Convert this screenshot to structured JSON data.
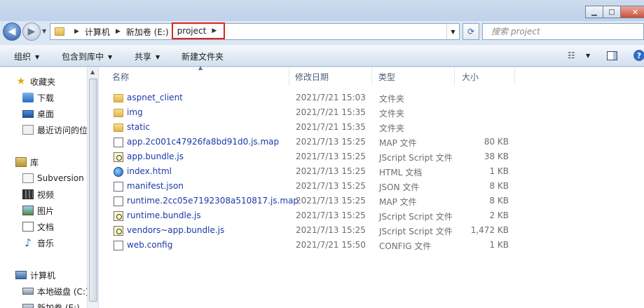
{
  "window": {
    "min_glyph": "▁",
    "max_glyph": "□",
    "close_glyph": "✕"
  },
  "address": {
    "back_glyph": "◀",
    "forward_glyph": "▶",
    "recent_glyph": "▼",
    "crumbs": [
      "计算机",
      "新加卷 (E:)",
      "project"
    ],
    "separator": "▶",
    "dropdown_glyph": "▼",
    "refresh_glyph": "⟳"
  },
  "search": {
    "placeholder": "搜索 project"
  },
  "toolbar": {
    "organize": "组织",
    "include_in_library": "包含到库中",
    "share": "共享",
    "new_folder": "新建文件夹",
    "dropdown_glyph": "▼",
    "views_glyph": "☷",
    "help_glyph": "?"
  },
  "nav": {
    "favorites": "收藏夹",
    "downloads": "下载",
    "desktop": "桌面",
    "recent": "最近访问的位置",
    "libraries": "库",
    "subversion": "Subversion",
    "videos": "视频",
    "pictures": "图片",
    "documents": "文档",
    "music": "音乐",
    "computer": "计算机",
    "local_disk": "本地磁盘 (C:)",
    "new_volume": "新加卷 (E:)",
    "star_glyph": "★",
    "music_glyph": "♪",
    "scroll_up_glyph": "▲"
  },
  "columns": {
    "name": "名称",
    "modified": "修改日期",
    "type": "类型",
    "size": "大小",
    "sort_glyph": "▲"
  },
  "files": [
    {
      "name": "aspnet_client",
      "modified": "2021/7/21 15:03",
      "type": "文件夹",
      "size": "",
      "icon": "folder-icon"
    },
    {
      "name": "img",
      "modified": "2021/7/21 15:35",
      "type": "文件夹",
      "size": "",
      "icon": "folder-icon"
    },
    {
      "name": "static",
      "modified": "2021/7/21 15:35",
      "type": "文件夹",
      "size": "",
      "icon": "folder-icon"
    },
    {
      "name": "app.2c001c47926fa8bd91d0.js.map",
      "modified": "2021/7/13 15:25",
      "type": "MAP 文件",
      "size": "80 KB",
      "icon": "file-icon"
    },
    {
      "name": "app.bundle.js",
      "modified": "2021/7/13 15:25",
      "type": "JScript Script 文件",
      "size": "38 KB",
      "icon": "script-icon"
    },
    {
      "name": "index.html",
      "modified": "2021/7/13 15:25",
      "type": "HTML 文档",
      "size": "1 KB",
      "icon": "html-icon"
    },
    {
      "name": "manifest.json",
      "modified": "2021/7/13 15:25",
      "type": "JSON 文件",
      "size": "8 KB",
      "icon": "file-icon"
    },
    {
      "name": "runtime.2cc05e7192308a510817.js.map",
      "modified": "2021/7/13 15:25",
      "type": "MAP 文件",
      "size": "8 KB",
      "icon": "file-icon"
    },
    {
      "name": "runtime.bundle.js",
      "modified": "2021/7/13 15:25",
      "type": "JScript Script 文件",
      "size": "2 KB",
      "icon": "script-icon"
    },
    {
      "name": "vendors~app.bundle.js",
      "modified": "2021/7/13 15:25",
      "type": "JScript Script 文件",
      "size": "1,472 KB",
      "icon": "script-icon"
    },
    {
      "name": "web.config",
      "modified": "2021/7/21 15:50",
      "type": "CONFIG 文件",
      "size": "1 KB",
      "icon": "file-icon"
    }
  ],
  "colors": {
    "highlight_border": "#e2231a",
    "link_blue": "#1a3aa8"
  }
}
